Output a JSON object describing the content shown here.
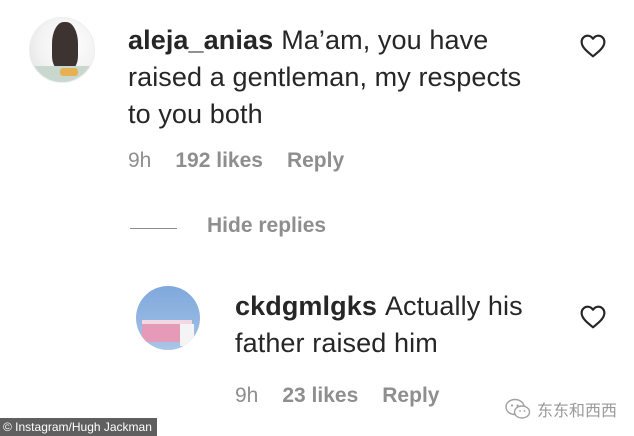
{
  "comments": [
    {
      "username": "aleja_anias",
      "text_line1": "Ma’am, you have",
      "text_line2": "raised a gentleman, my respects",
      "text_line3": "to you both",
      "time": "9h",
      "likes": "192 likes",
      "reply": "Reply"
    }
  ],
  "hide_replies": "Hide replies",
  "replies": [
    {
      "username": "ckdgmlgks",
      "text_line1": "Actually his",
      "text_line2": "father raised him",
      "time": "9h",
      "likes": "23 likes",
      "reply": "Reply"
    }
  ],
  "credit": "© Instagram/Hugh Jackman",
  "watermark": "东东和西西",
  "icons": {
    "like": "heart-outline-icon",
    "watermark": "wechat-logo-icon"
  },
  "colors": {
    "text": "#262626",
    "secondary": "#8e8e8e"
  }
}
